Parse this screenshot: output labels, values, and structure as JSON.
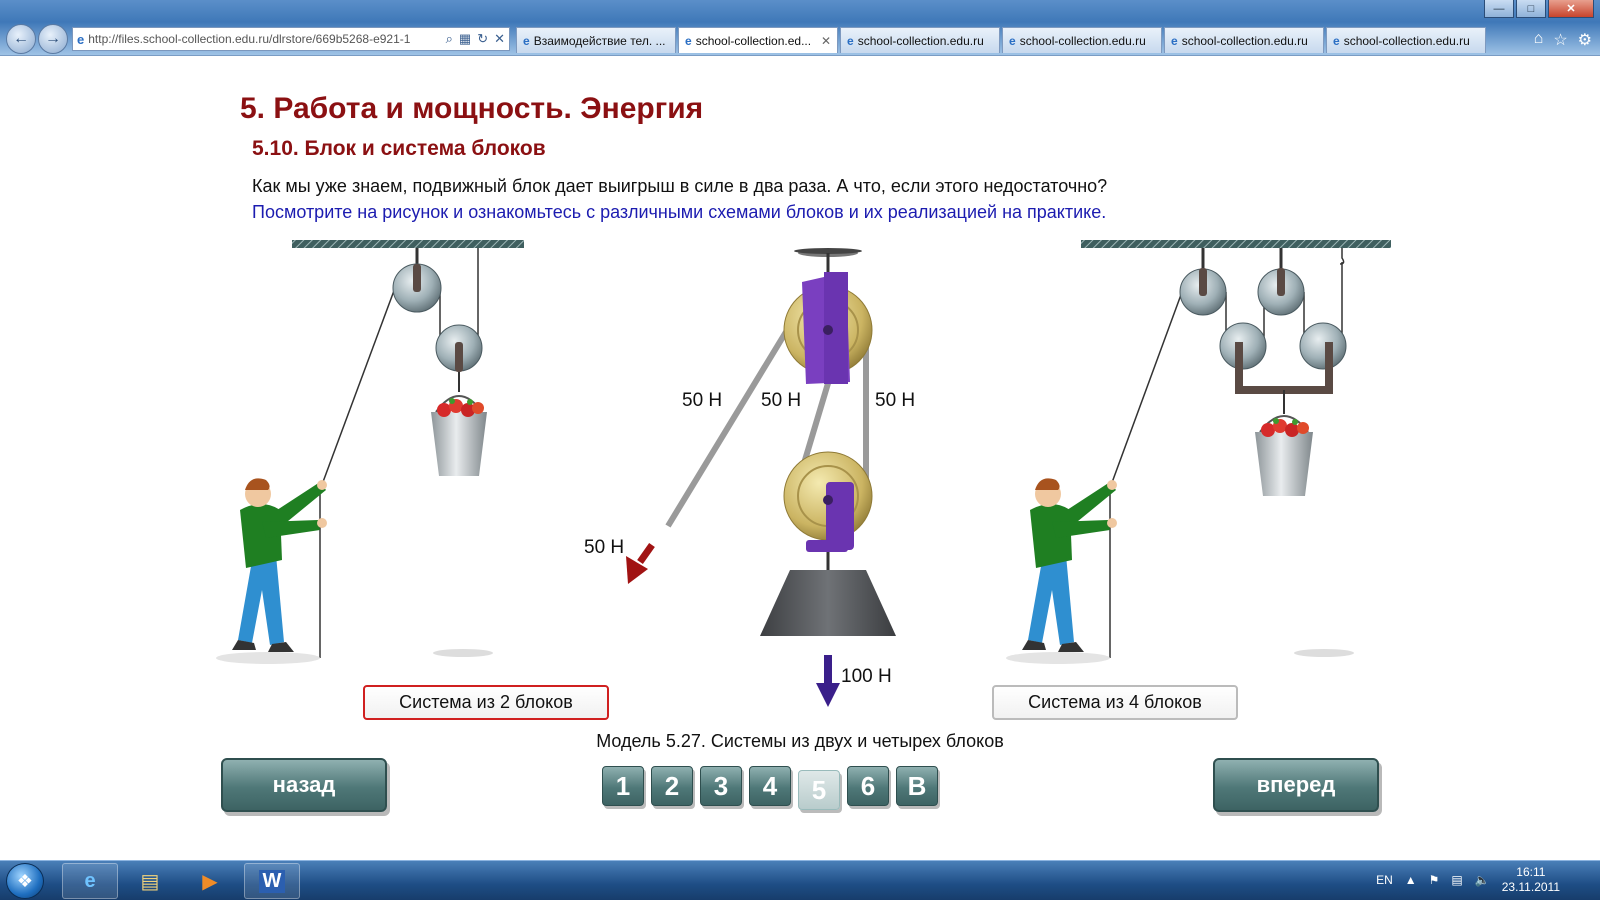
{
  "browser": {
    "url": "http://files.school-collection.edu.ru/dlrstore/669b5268-e921-1",
    "tabs": [
      {
        "label": "Взаимодействие тел. ...",
        "active": false
      },
      {
        "label": "school-collection.ed...",
        "active": true
      },
      {
        "label": "school-collection.edu.ru",
        "active": false
      },
      {
        "label": "school-collection.edu.ru",
        "active": false
      },
      {
        "label": "school-collection.edu.ru",
        "active": false
      },
      {
        "label": "school-collection.edu.ru",
        "active": false
      }
    ],
    "window_controls": [
      "minimize",
      "maximize",
      "close"
    ]
  },
  "page": {
    "title": "5. Работа и мощность. Энергия",
    "subtitle": "5.10. Блок и система блоков",
    "intro": "Как мы уже знаем, подвижный блок дает выигрыш в силе в два раза. А что, если этого недостаточно?",
    "instruction": "Посмотрите на рисунок и ознакомьтесь с различными схемами блоков и их реализацией на практике.",
    "forces": {
      "rope_left": "50 Н",
      "rope_middle": "50 Н",
      "rope_right": "50 Н",
      "pull": "50 Н",
      "weight": "100 Н"
    },
    "buttons": {
      "system_two": "Система из 2 блоков",
      "system_four": "Система из 4 блоков",
      "back": "назад",
      "forward": "вперед"
    },
    "caption": "Модель 5.27. Системы из двух и четырех блоков",
    "pager": [
      {
        "label": "1",
        "current": false
      },
      {
        "label": "2",
        "current": false
      },
      {
        "label": "3",
        "current": false
      },
      {
        "label": "4",
        "current": false
      },
      {
        "label": "5",
        "current": true
      },
      {
        "label": "6",
        "current": false
      },
      {
        "label": "В",
        "current": false
      }
    ]
  },
  "taskbar": {
    "language": "EN",
    "time": "16:11",
    "date": "23.11.2011"
  },
  "colors": {
    "title": "#8b1012",
    "instruction": "#1c1cb0",
    "button_teal": "#4f7878",
    "active_system_border": "#d02020"
  }
}
